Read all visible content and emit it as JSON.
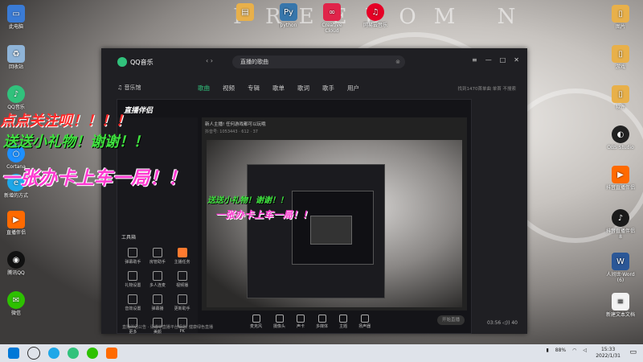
{
  "desktop": {
    "watermark": "FREEDOM N",
    "left_icons": [
      {
        "label": "此电脑",
        "icon": "computer-icon",
        "color": "#3a7bd5"
      },
      {
        "label": "回收站",
        "icon": "recycle-bin-icon",
        "color": "#8fb4d8"
      },
      {
        "label": "QQ音乐",
        "icon": "qq-music-icon",
        "color": "#31c27c"
      },
      {
        "label": "Cortana",
        "icon": "cortana-icon",
        "color": "#1e90ff"
      },
      {
        "label": "新增的方式",
        "icon": "browser-icon",
        "color": "#1ea7e8"
      },
      {
        "label": "直播伴侣",
        "icon": "live-companion-icon",
        "color": "#ff6a00"
      },
      {
        "label": "腾讯QQ",
        "icon": "qq-icon",
        "color": "#111111"
      },
      {
        "label": "微信",
        "icon": "wechat-icon",
        "color": "#2dc100"
      }
    ],
    "top_icons": [
      {
        "label": "",
        "icon": "folder-icon",
        "color": "#e8b04a"
      },
      {
        "label": "python",
        "icon": "python-icon",
        "color": "#3776ab"
      },
      {
        "label": "Creative Cloud",
        "icon": "creative-cloud-icon",
        "color": "#e0244a"
      },
      {
        "label": "网易云音乐",
        "icon": "netease-music-icon",
        "color": "#e60026"
      }
    ],
    "right_icons": [
      {
        "label": "图片",
        "icon": "file-icon",
        "color": "#e8b04a"
      },
      {
        "label": "游戏",
        "icon": "file-icon",
        "color": "#e8b04a"
      },
      {
        "label": "软件",
        "icon": "file-icon",
        "color": "#e8b04a"
      },
      {
        "label": "OBS Studio",
        "icon": "obs-icon",
        "color": "#222222"
      },
      {
        "label": "抖音直播伴侣",
        "icon": "live-companion-icon",
        "color": "#ff6a00"
      },
      {
        "label": "抖音直播伴侣 8",
        "icon": "douyin-icon",
        "color": "#1a1a1a"
      },
      {
        "label": "人间世·Word (6)",
        "icon": "word-icon",
        "color": "#2b5797"
      },
      {
        "label": "新建文本文档",
        "icon": "text-file-icon",
        "color": "#f2f2f2"
      }
    ]
  },
  "qq_music": {
    "title": "QQ音乐",
    "search_value": "直播的歌曲",
    "nav": [
      "歌曲",
      "视频",
      "专辑",
      "歌单",
      "歌词",
      "歌手",
      "用户"
    ],
    "sidebar_label": "音乐馆",
    "right_info": "找到1470首单曲   单首   不搜索",
    "time": "03:56",
    "volume": "40"
  },
  "live": {
    "app_title": "直播伴侣",
    "stream_title": "新人主播! 任何游戏都可以玩哦",
    "stream_meta": "抖音号: 1053443  · 612  · 37",
    "tool_section": "工具箱",
    "tools": [
      "弹幕助手",
      "房管助手",
      "主播任务",
      "礼物设置",
      "多人连麦",
      "视频播",
      "音效设置",
      "弹幕播",
      "更新助手",
      "更多",
      "美颜",
      "PK"
    ],
    "bottom_buttons": [
      "麦克风",
      "摄像头",
      "声卡",
      "多媒体",
      "主题",
      "扬声器"
    ],
    "live_button": "开始直播",
    "notice": "直播伴侣公告 · 请遵守直播平台规范, 健康绿色直播"
  },
  "captions": {
    "line1": "点点关注呗！！！！",
    "line2": "送送小礼物！谢谢！！",
    "line3": "一张办卡上车一局！！",
    "line4": "送送小礼物！谢谢！！",
    "line5": "一张办卡上车一局！！"
  },
  "taskbar": {
    "time": "15:33",
    "date": "2022/1/31",
    "battery": "88%"
  }
}
